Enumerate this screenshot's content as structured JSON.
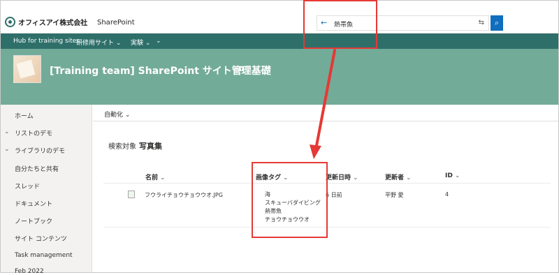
{
  "suite": {
    "brand_name": "オフィスアイ株式会社",
    "app_name": "SharePoint",
    "search_value": "熱帯魚",
    "search_back_glyph": "←",
    "search_filter_glyph": "⇆",
    "search_button_glyph": "⌕"
  },
  "hub": {
    "items": [
      "Hub for training sites",
      "研修用サイト ⌄",
      "実験 ⌄",
      "⌄"
    ]
  },
  "site": {
    "title": "[Training team] SharePoint サイト管理基礎",
    "title_icon": "✿"
  },
  "leftnav": {
    "items": [
      {
        "label": "ホーム",
        "chevron": ""
      },
      {
        "label": "リストのデモ",
        "chevron": "⌄"
      },
      {
        "label": "ライブラリのデモ",
        "chevron": "⌄"
      },
      {
        "label": "自分たちと共有",
        "chevron": ""
      },
      {
        "label": "スレッド",
        "chevron": ""
      },
      {
        "label": "ドキュメント",
        "chevron": ""
      },
      {
        "label": "ノートブック",
        "chevron": ""
      },
      {
        "label": "サイト コンテンツ",
        "chevron": ""
      },
      {
        "label": "Task management",
        "chevron": ""
      },
      {
        "label": "Feb 2022",
        "chevron": ""
      }
    ]
  },
  "cmdbar": {
    "automate_label": "自動化 ⌄"
  },
  "content": {
    "search_for_label": "検索対象",
    "search_for_value": "写真集",
    "columns": [
      "名前",
      "画像タグ",
      "更新日時",
      "更新者",
      "ID"
    ],
    "caret": "⌄",
    "row": {
      "name": "フウライチョウチョウウオ.JPG",
      "tags": [
        "海",
        "スキューバダイビング",
        "熱帯魚",
        "チョウチョウウオ"
      ],
      "modified": "6 日前",
      "modified_by": "平野 愛",
      "id": "4"
    }
  },
  "colors": {
    "hub_bar": "#2f6f6a",
    "site_header": "#73ab99",
    "accent": "#106ebe",
    "highlight": "#e53935"
  }
}
